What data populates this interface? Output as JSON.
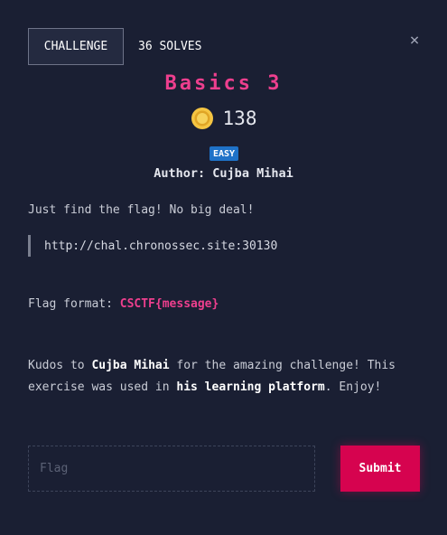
{
  "header": {
    "tab_challenge": "CHALLENGE",
    "tab_solves": "36 SOLVES",
    "close_symbol": "×"
  },
  "challenge": {
    "title": "Basics 3",
    "points": "138",
    "difficulty": "EASY",
    "author": "Author: Cujba Mihai",
    "description": "Just find the flag! No big deal!",
    "url": "http://chal.chronossec.site:30130",
    "flag_format_label": "Flag format: ",
    "flag_format_value": "CSCTF{message}",
    "kudos": {
      "prefix": "Kudos to ",
      "name": "Cujba Mihai",
      "middle": " for the amazing challenge! This exercise was used in ",
      "platform": "his learning platform",
      "suffix": ". Enjoy!"
    }
  },
  "submission": {
    "placeholder": "Flag",
    "value": "",
    "submit_label": "Submit"
  },
  "icons": {
    "points": "coin-icon",
    "close": "close-icon"
  },
  "colors": {
    "background": "#1a1f33",
    "title": "#ee3f8e",
    "badge": "#1f72c8",
    "submit": "#d6034f",
    "coin": "#f5c542"
  }
}
